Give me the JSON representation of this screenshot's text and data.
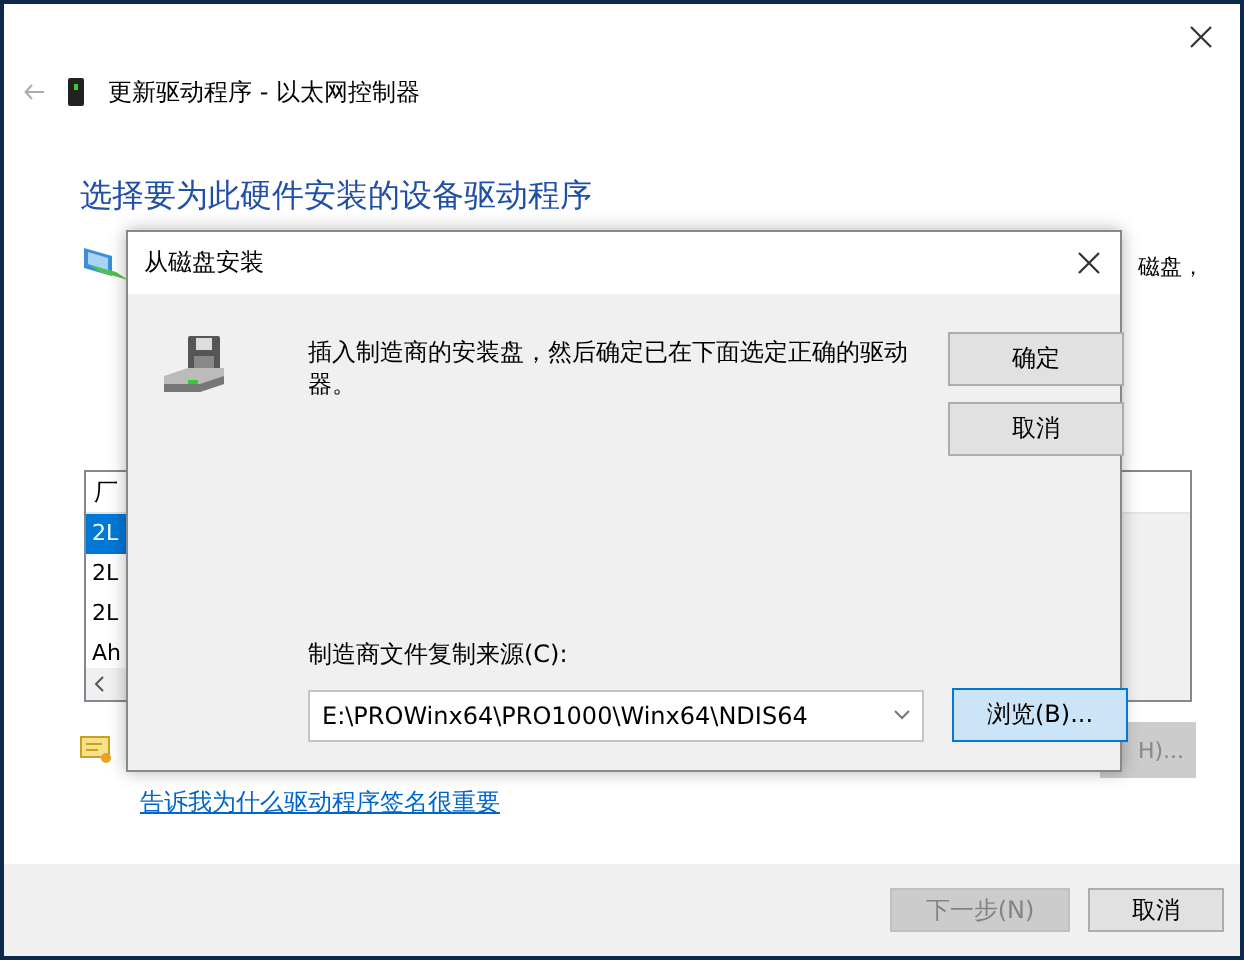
{
  "window": {
    "title": "更新驱动程序 - 以太网控制器",
    "heading": "选择要为此硬件安装的设备驱动程序",
    "instruction_fragment": "磁盘，",
    "list": {
      "header": "厂",
      "rows": [
        {
          "text": "2L",
          "selected": true
        },
        {
          "text": "2L",
          "selected": false
        },
        {
          "text": "2L",
          "selected": false
        },
        {
          "text": "Ah",
          "selected": false
        }
      ]
    },
    "have_disk_button": "H)...",
    "link": "告诉我为什么驱动程序签名很重要",
    "buttons": [
      {
        "label": "下一步(N)",
        "disabled": true
      },
      {
        "label": "取消",
        "disabled": false
      }
    ]
  },
  "dialog": {
    "title": "从磁盘安装",
    "message": "插入制造商的安装盘，然后确定已在下面选定正确的驱动器。",
    "buttons": [
      {
        "label": "确定",
        "selected": false
      },
      {
        "label": "取消",
        "selected": false
      }
    ],
    "source_label": "制造商文件复制来源(C):",
    "source_value": "E:\\PROWinx64\\PRO1000\\Winx64\\NDIS64",
    "browse_button": "浏览(B)..."
  }
}
